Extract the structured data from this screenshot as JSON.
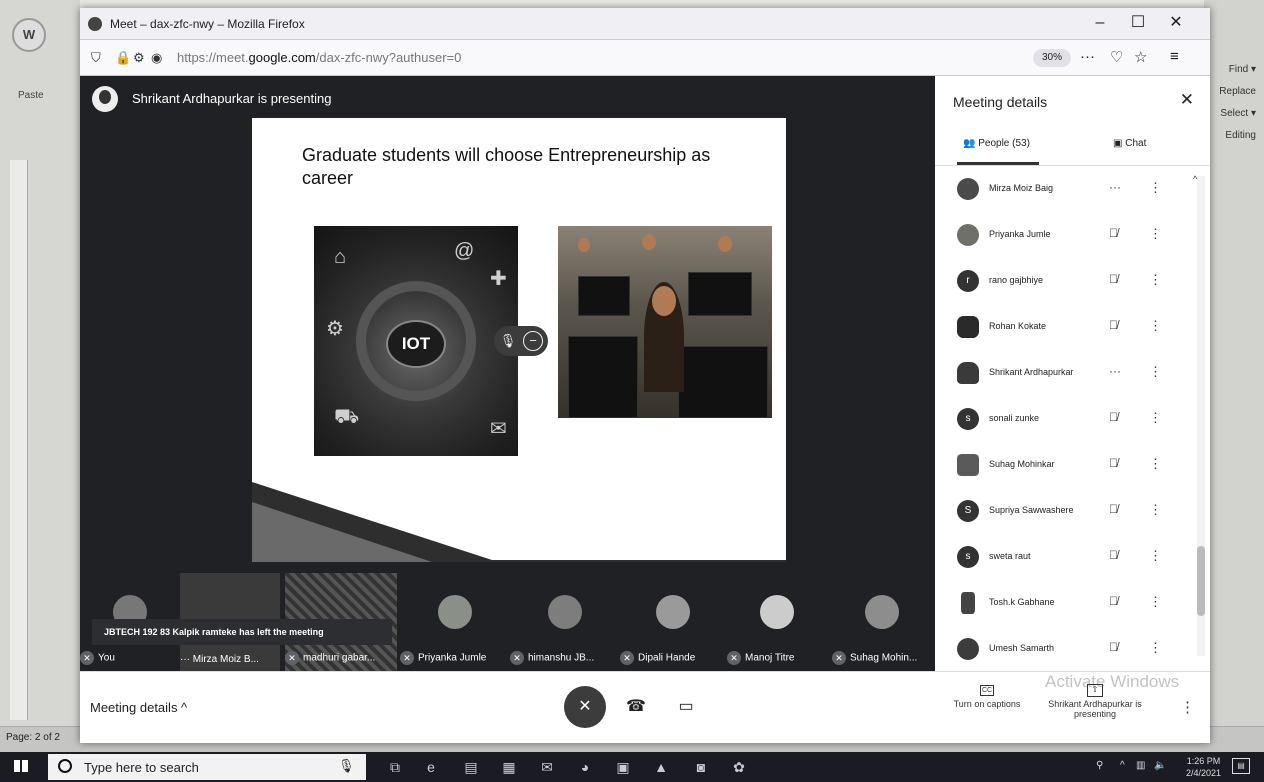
{
  "word": {
    "paste_label": "Paste",
    "ribbon_right": [
      "Find ▾",
      "Replace",
      "Select ▾",
      "Editing"
    ],
    "status_page": "Page: 2 of 2"
  },
  "firefox": {
    "window_title": "Meet – dax-zfc-nwy – Mozilla Firefox",
    "url_prefix": "https://meet.",
    "url_domain": "google.com",
    "url_path": "/dax-zfc-nwy?authuser=0",
    "zoom": "30%",
    "minimize": "–",
    "maximize": "☐",
    "close": "✕"
  },
  "meet": {
    "presenter_text": "Shrikant Ardhapurkar is presenting",
    "slide": {
      "title": "Graduate students will choose Entrepreneurship as career",
      "iot_label": "IOT"
    },
    "toast": "JBTECH 192 83 Kalpik ramteke has left the meeting",
    "tiles": [
      {
        "label": "You"
      },
      {
        "label": "Mirza Moiz B..."
      },
      {
        "label": "madhuri gabar..."
      },
      {
        "label": "Priyanka Jumle"
      },
      {
        "label": "himanshu JB..."
      },
      {
        "label": "Dipali Hande"
      },
      {
        "label": "Manoj Titre"
      },
      {
        "label": "Suhag Mohin..."
      }
    ],
    "controls": {
      "meeting_details": "Meeting details  ^",
      "captions_label": "Turn on captions",
      "captions_icon": "CC",
      "presenting_label": "Shrikant Ardhapurkar is presenting",
      "activate_text": "Activate Windows"
    }
  },
  "panel": {
    "title": "Meeting details",
    "close": "✕",
    "tab_people": "People (53)",
    "tab_chat": "Chat",
    "people": [
      {
        "name": "Mirza Moiz Baig",
        "initial": "",
        "status": "···"
      },
      {
        "name": "Priyanka Jumle",
        "initial": "",
        "status": "muted"
      },
      {
        "name": "rano gajbhiye",
        "initial": "r",
        "status": "muted"
      },
      {
        "name": "Rohan Kokate",
        "initial": "",
        "status": "muted"
      },
      {
        "name": "Shrikant Ardhapurkar",
        "initial": "",
        "status": "···"
      },
      {
        "name": "sonali zunke",
        "initial": "s",
        "status": "muted"
      },
      {
        "name": "Suhag Mohinkar",
        "initial": "",
        "status": "muted"
      },
      {
        "name": "Supriya Sawwashere",
        "initial": "S",
        "status": "muted"
      },
      {
        "name": "sweta raut",
        "initial": "s",
        "status": "muted"
      },
      {
        "name": "Tosh.k Gabhane",
        "initial": "",
        "status": "muted"
      },
      {
        "name": "Umesh Samarth",
        "initial": "",
        "status": "muted"
      }
    ]
  },
  "taskbar": {
    "search_placeholder": "Type here to search",
    "time": "1:26 PM",
    "date": "2/4/2021"
  }
}
